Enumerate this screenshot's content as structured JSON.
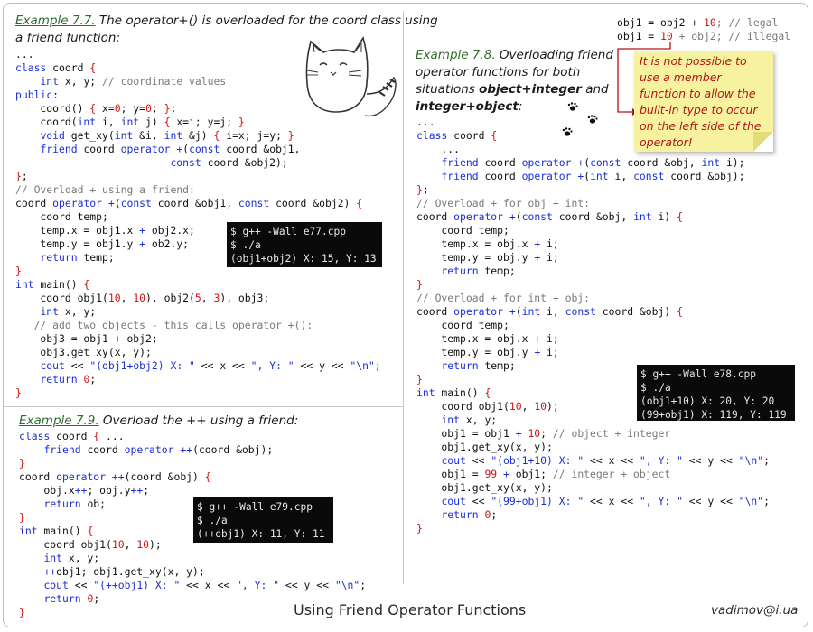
{
  "ex77": {
    "label": "Example 7.7.",
    "text1": " The operator+() is overloaded for the coord class using",
    "text2": "a friend function:",
    "terminal": "$ g++ -Wall e77.cpp\n$ ./a\n(obj1+obj2) X: 15, Y: 13"
  },
  "ex78": {
    "label": "Example 7.8.",
    "line1": " Overloading friend",
    "line2": "operator functions for both",
    "line3_pre": "situations ",
    "line3_bold": "object+integer",
    "line3_post": " and",
    "line4_bold": "integer+object",
    "line4_post": ":",
    "terminal": "$ g++ -Wall e78.cpp\n$ ./a\n(obj1+10) X: 20, Y: 20\n(99+obj1) X: 119, Y: 119"
  },
  "ex79": {
    "label": "Example 7.9.",
    "text": " Overload the ++ using a friend:",
    "terminal": "$ g++ -Wall e79.cpp\n$ ./a\n(++obj1) X: 11, Y: 11"
  },
  "legal_line": {
    "code": "obj1 = obj2 + ",
    "num": "10",
    "rest": "; // legal"
  },
  "illegal_line": {
    "code1": "obj1 = ",
    "num": "10",
    "code2": " + obj2; // illegal"
  },
  "note": "It is not possible to use a member function to allow the built-in type to occur on the left side of the  operator!",
  "footer": {
    "title": "Using Friend Operator Functions",
    "email": "vadimov@i.ua"
  },
  "colors": {
    "keyword": "#1b2fd6",
    "comment": "#7a7a7a",
    "brace": "#cf1414",
    "example_label": "#2c6e28",
    "note_bg": "#f7f2a0",
    "note_text": "#b01616"
  },
  "icons": [
    "cat-drawing",
    "paw-prints-icon",
    "arrow-connector"
  ]
}
